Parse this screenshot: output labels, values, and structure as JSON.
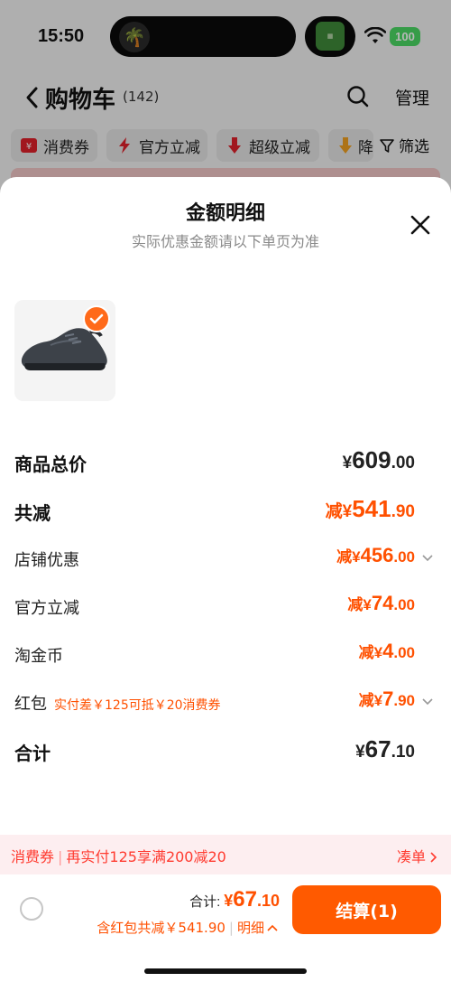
{
  "status_bar": {
    "time": "15:50",
    "battery": "100"
  },
  "navbar": {
    "title": "购物车",
    "count": "(142)",
    "manage_label": "管理"
  },
  "filters": {
    "chips": [
      {
        "label": "消费券",
        "icon": "coupon-icon",
        "color": "#e0202a"
      },
      {
        "label": "官方立减",
        "icon": "lightning-icon",
        "color": "#e0202a"
      },
      {
        "label": "超级立减",
        "icon": "down-arrow-icon",
        "color": "#e0202a"
      },
      {
        "label": "降",
        "icon": "arrow-down-icon",
        "color": "#f0a020"
      }
    ],
    "filter_label": "筛选"
  },
  "sheet": {
    "title": "金额明细",
    "subtitle": "实际优惠金额请以下单页为准",
    "rows": {
      "goods_total": {
        "label": "商品总价",
        "prefix": "¥",
        "int": "609",
        "dec": ".00"
      },
      "total_reduction": {
        "label": "共减",
        "prefix": "减¥",
        "int": "541",
        "dec": ".90"
      },
      "store_discount": {
        "label": "店铺优惠",
        "prefix": "减¥",
        "int": "456",
        "dec": ".00"
      },
      "official_reduction": {
        "label": "官方立减",
        "prefix": "减¥",
        "int": "74",
        "dec": ".00"
      },
      "taobao_coins": {
        "label": "淘金币",
        "prefix": "减¥",
        "int": "4",
        "dec": ".00"
      },
      "red_packet": {
        "label": "红包",
        "note": "实付差￥125可抵￥20消费券",
        "prefix": "减¥",
        "int": "7",
        "dec": ".90"
      },
      "grand_total": {
        "label": "合计",
        "prefix": "¥",
        "int": "67",
        "dec": ".10"
      }
    }
  },
  "promo_bar": {
    "tag": "消费券",
    "text": "再实付125享满200减20",
    "link": "凑单"
  },
  "footer": {
    "total_label": "合计:",
    "total_prefix": "¥",
    "total_int": "67",
    "total_dec": ".10",
    "sub_text": "含红包共减￥541.90",
    "detail_label": "明细",
    "checkout_label": "结算(1)"
  },
  "colors": {
    "accent": "#ff5000",
    "checkout": "#ff5a00",
    "promo_bg": "#fdeef0",
    "promo_text": "#ff3b30"
  }
}
